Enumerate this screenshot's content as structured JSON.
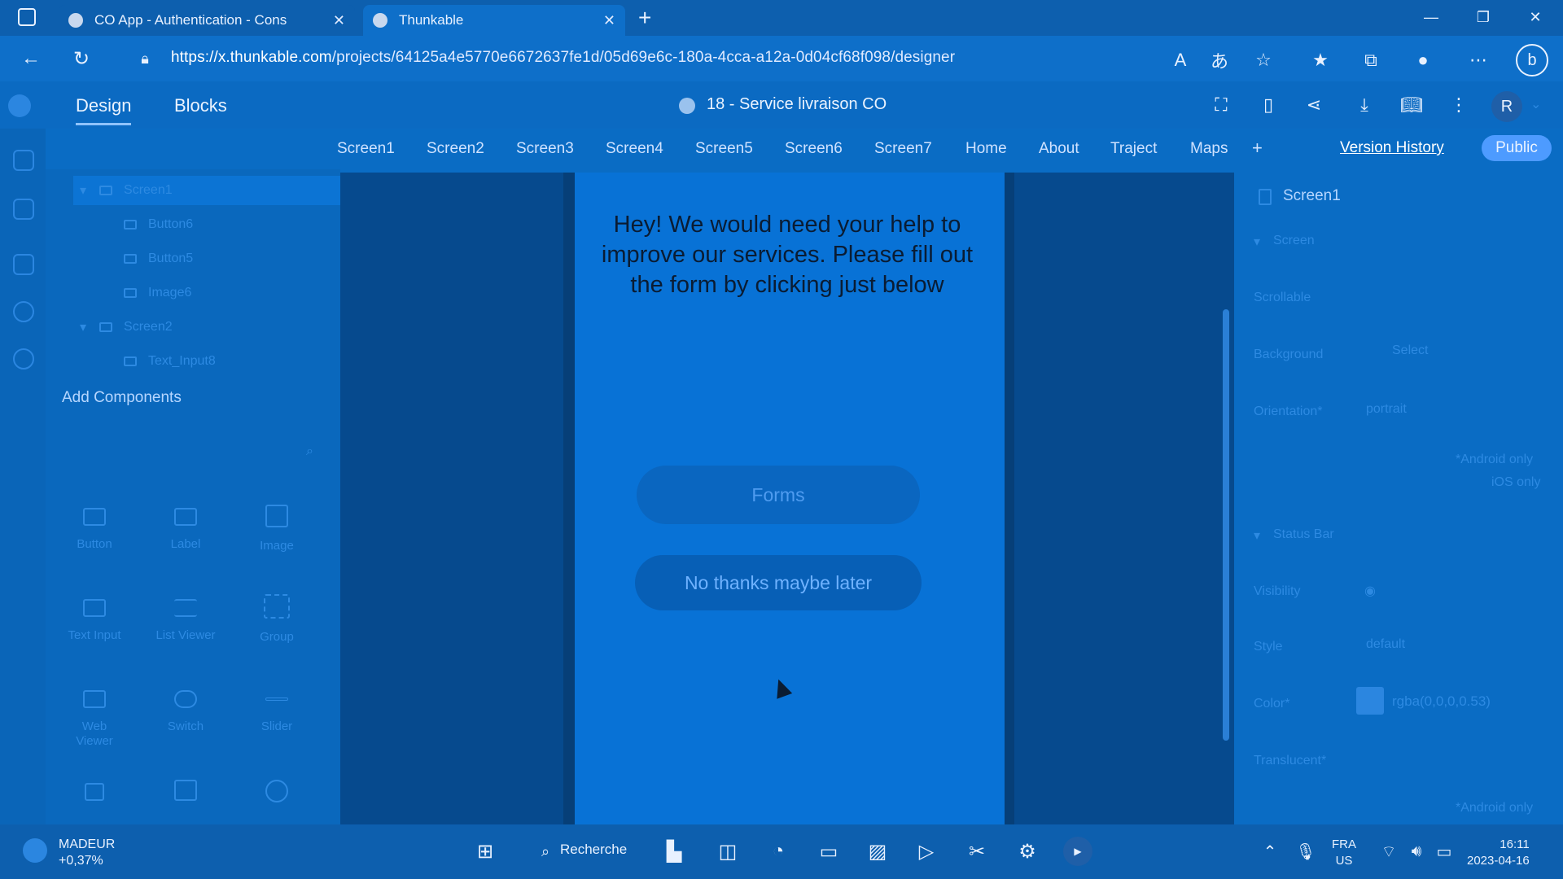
{
  "browser": {
    "tabs": [
      {
        "label": "CO App - Authentication - Cons",
        "close": "✕"
      },
      {
        "label": "Thunkable",
        "close": "✕"
      }
    ],
    "new_tab": "+",
    "url_host": "https://x.thunkable.com",
    "url_path": "/projects/64125a4e5770e6672637fe1d/05d69e6c-180a-4cca-a12a-0d04cf68f098/designer",
    "window_controls": {
      "minimize": "—",
      "restore": "❐",
      "close": "✕"
    }
  },
  "app": {
    "modes": {
      "design": "Design",
      "blocks": "Blocks"
    },
    "project_title": "18 - Service livraison CO",
    "avatar": "R",
    "screen_tabs": [
      "Screen1",
      "Screen2",
      "Screen3",
      "Screen4",
      "Screen5",
      "Screen6",
      "Screen7",
      "Home",
      "About",
      "Traject",
      "Maps"
    ],
    "add_screen": "+",
    "version_history": "Version History",
    "public": "Public"
  },
  "tree": {
    "items": [
      {
        "label": "Screen1"
      },
      {
        "label": "Button6"
      },
      {
        "label": "Button5"
      },
      {
        "label": "Image6"
      },
      {
        "label": "Screen2"
      },
      {
        "label": "Text_Input8"
      }
    ],
    "add_components": "Add Components",
    "components": [
      {
        "label": "Button"
      },
      {
        "label": "Label"
      },
      {
        "label": "Image"
      },
      {
        "label": "Text Input"
      },
      {
        "label": "List Viewer"
      },
      {
        "label": "Group"
      },
      {
        "label": "Web Viewer"
      },
      {
        "label": "Switch"
      },
      {
        "label": "Slider"
      }
    ]
  },
  "phone": {
    "message": "Hey! We would need your help to improve our services. Please fill out the form by clicking just below",
    "forms_button": "Forms",
    "later_button": "No thanks maybe later"
  },
  "properties": {
    "title": "Screen1",
    "section_screen": "Screen",
    "scrollable": "Scrollable",
    "background": "Background",
    "background_value": "Select",
    "orientation": "Orientation*",
    "orientation_value": "portrait",
    "android_only": "*Android only",
    "ios_only": "iOS only",
    "section_status": "Status Bar",
    "visibility": "Visibility",
    "style": "Style",
    "style_value": "default",
    "color": "Color*",
    "color_value": "rgba(0,0,0,0.53)",
    "translucent": "Translucent*",
    "android_only_2": "*Android only"
  },
  "taskbar": {
    "stock_name": "MADEUR",
    "stock_change": "+0,37%",
    "search": "Recherche",
    "lang": "FRA",
    "region": "US",
    "time": "16:11",
    "date": "2023-04-16"
  }
}
